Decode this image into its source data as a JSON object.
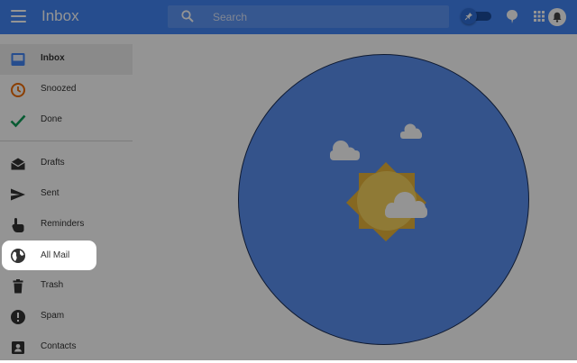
{
  "header": {
    "title": "Inbox",
    "search_placeholder": "Search",
    "colors": {
      "primary": "#4285f4",
      "search_bg": "#5e97f6"
    },
    "icons": [
      "menu-icon",
      "search-icon",
      "pin-icon",
      "speech-bubble-icon",
      "apps-grid-icon",
      "bell-icon"
    ]
  },
  "sidebar": {
    "items": [
      {
        "label": "Inbox",
        "icon": "inbox-icon",
        "color": "#4285f4",
        "active": true
      },
      {
        "label": "Snoozed",
        "icon": "clock-icon",
        "color": "#ef6c00"
      },
      {
        "label": "Done",
        "icon": "check-icon",
        "color": "#0f9d58"
      },
      {
        "label": "Drafts",
        "icon": "drafts-icon",
        "color": "#333333"
      },
      {
        "label": "Sent",
        "icon": "send-icon",
        "color": "#333333"
      },
      {
        "label": "Reminders",
        "icon": "reminder-hand-icon",
        "color": "#333333"
      },
      {
        "label": "All Mail",
        "icon": "globe-icon",
        "color": "#333333",
        "highlighted": true
      },
      {
        "label": "Trash",
        "icon": "trash-icon",
        "color": "#333333"
      },
      {
        "label": "Spam",
        "icon": "spam-icon",
        "color": "#333333"
      },
      {
        "label": "Contacts",
        "icon": "contacts-icon",
        "color": "#333333"
      }
    ]
  },
  "main": {
    "illustration": "sun-and-clouds-icon",
    "colors": {
      "sky": "#5b8ff0",
      "sun": "#f2c443"
    }
  }
}
